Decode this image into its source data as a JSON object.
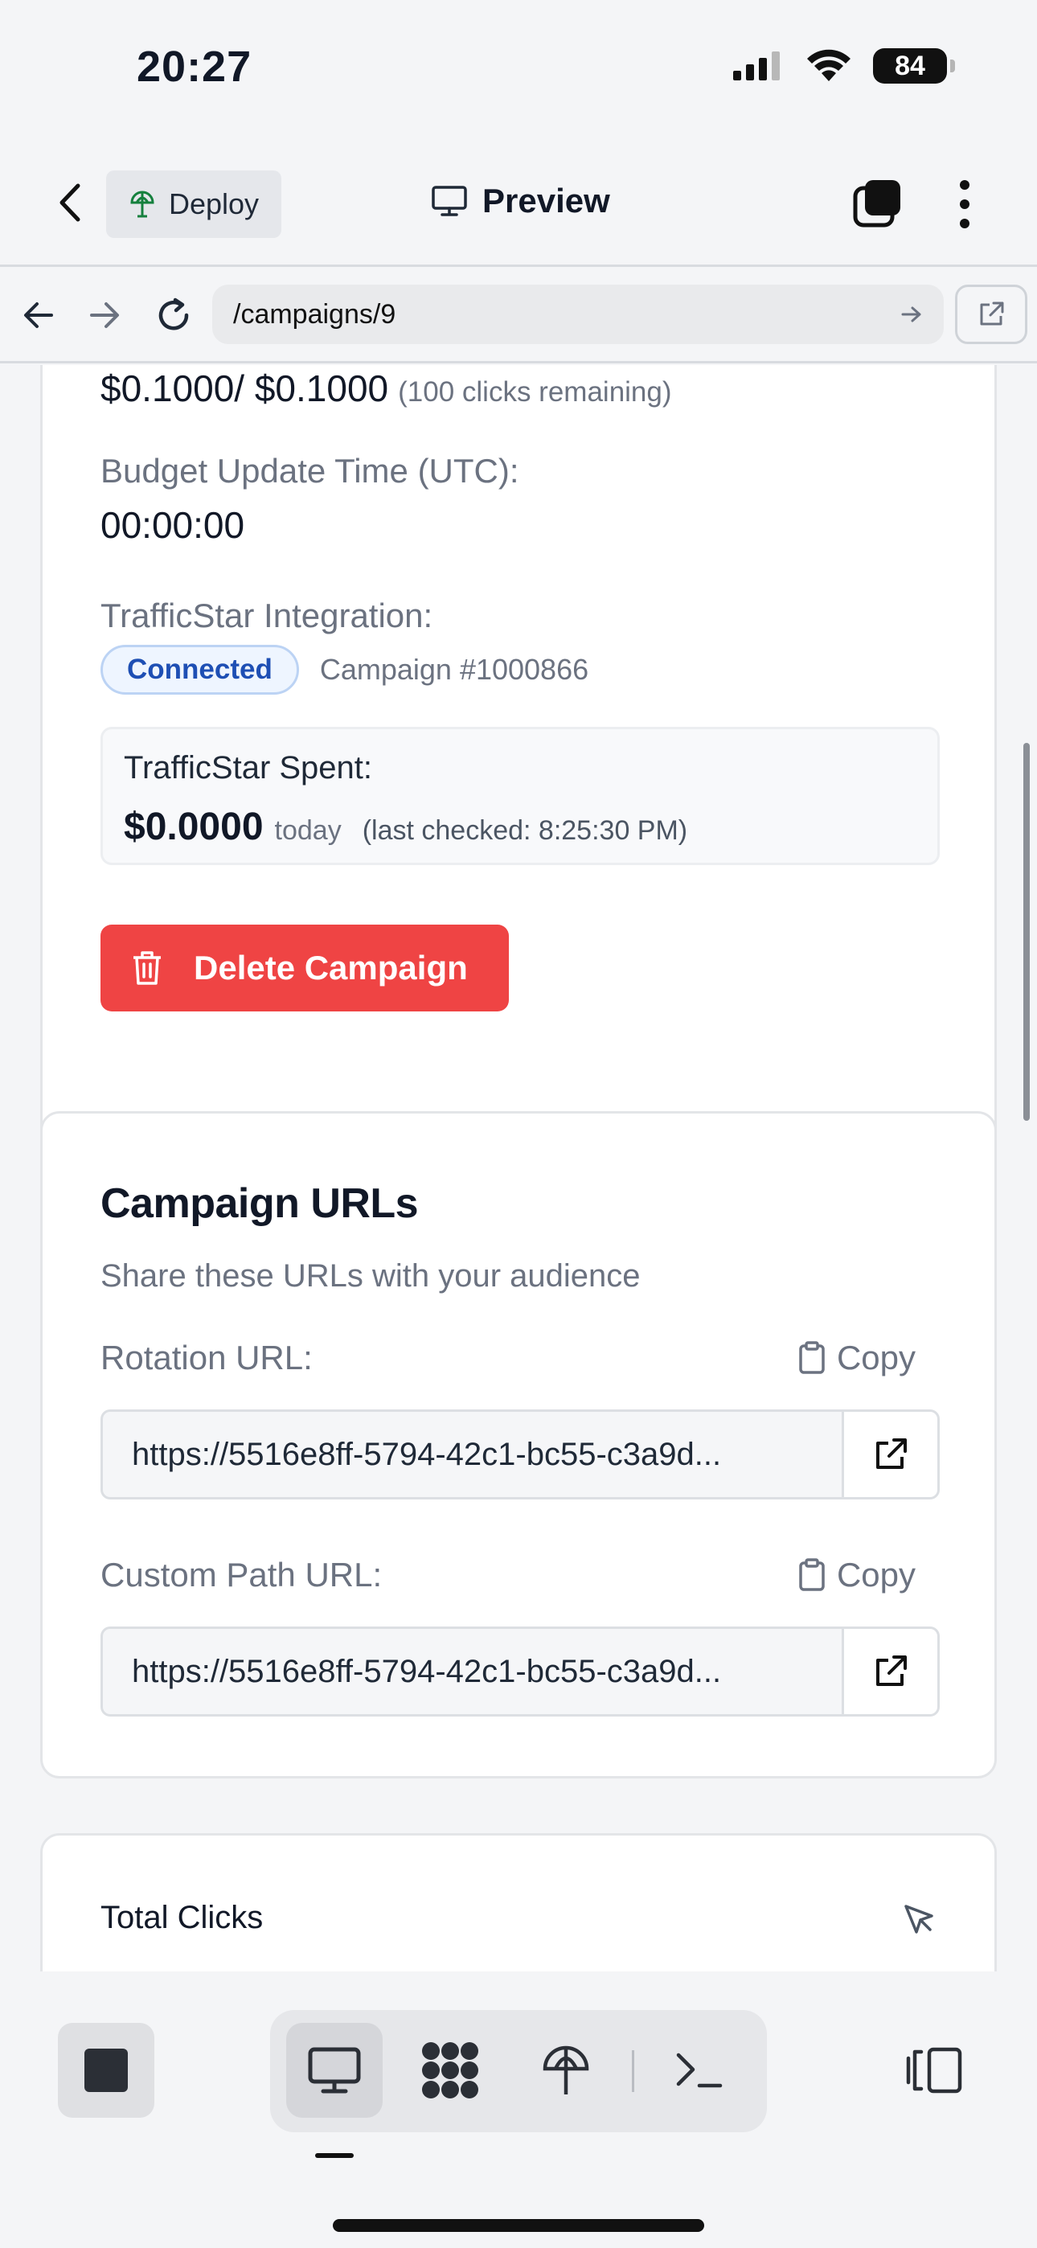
{
  "status_bar": {
    "time": "20:27",
    "battery": "84"
  },
  "header": {
    "deploy_label": "Deploy",
    "title": "Preview"
  },
  "url_bar": {
    "path": "/campaigns/9"
  },
  "budget_card": {
    "budget_amount": "$0.1000/ $0.1000",
    "budget_remaining": "(100 clicks remaining)",
    "update_time_label": "Budget Update Time (UTC):",
    "update_time_value": "00:00:00",
    "integration_label": "TrafficStar Integration:",
    "integration_status": "Connected",
    "integration_campaign": "Campaign #1000866",
    "spent_label": "TrafficStar Spent:",
    "spent_amount": "$0.0000",
    "spent_period": "today",
    "spent_checked": "(last checked: 8:25:30 PM)",
    "delete_label": "Delete Campaign"
  },
  "urls_card": {
    "title": "Campaign URLs",
    "description": "Share these URLs with your audience",
    "copy_label": "Copy",
    "rotation_label": "Rotation URL:",
    "rotation_value": "https://5516e8ff-5794-42c1-bc55-c3a9d...",
    "custom_label": "Custom Path URL:",
    "custom_value": "https://5516e8ff-5794-42c1-bc55-c3a9d..."
  },
  "clicks_card": {
    "title": "Total Clicks"
  },
  "colors": {
    "accent_danger": "#ef4444",
    "badge_blue": "#1e4fb4",
    "muted_text": "#6b7280"
  },
  "icons": {
    "deploy": "globe-antenna-icon",
    "preview": "monitor-icon",
    "tabs": "tabs-square-icon",
    "more": "more-vertical-icon",
    "delete": "trash-icon",
    "copy": "clipboard-icon",
    "open": "external-link-icon",
    "clicks": "cursor-pointer-icon",
    "toolbar": [
      "stop-icon",
      "monitor-icon",
      "command-icon",
      "deploy-icon",
      "terminal-icon",
      "panel-toggle-icon"
    ]
  }
}
